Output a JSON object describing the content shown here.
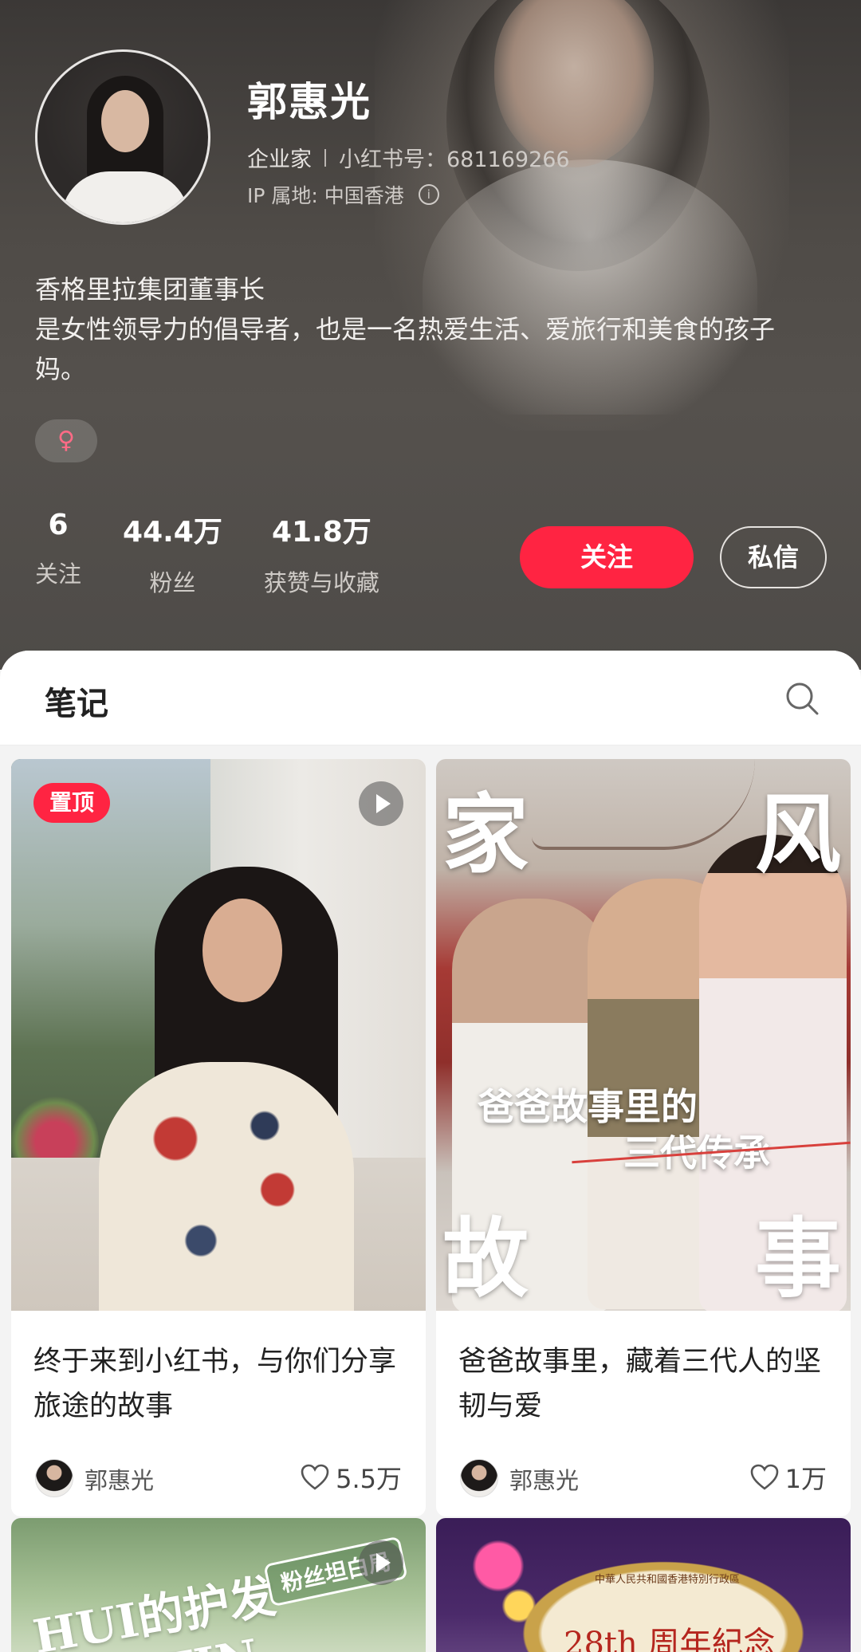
{
  "profile": {
    "name": "郭惠光",
    "role": "企业家",
    "id_label": "小红书号：681169266",
    "ip_location": "IP 属地: 中国香港",
    "info_symbol": "i",
    "bio_line1": "香格里拉集团董事长",
    "bio_line2": "是女性领导力的倡导者，也是一名热爱生活、爱旅行和美食的孩子妈。",
    "gender_symbol": "♀"
  },
  "stats": [
    {
      "value": "6",
      "label": "关注"
    },
    {
      "value": "44.4万",
      "label": "粉丝"
    },
    {
      "value": "41.8万",
      "label": "获赞与收藏"
    }
  ],
  "actions": {
    "follow_label": "关注",
    "message_label": "私信"
  },
  "notes": {
    "title": "笔记",
    "cards": [
      {
        "pin_label": "置顶",
        "title": "终于来到小红书，与你们分享旅途的故事",
        "author": "郭惠光",
        "likes": "5.5万"
      },
      {
        "cover_chars": [
          "家",
          "风",
          "故",
          "事"
        ],
        "cover_line1": "爸爸故事里的",
        "cover_line2": "三代传承",
        "title": "爸爸故事里，藏着三代人的坚韧与爱",
        "author": "郭惠光",
        "likes": "1万"
      },
      {
        "cover_text": "HUI的护发 ROUTIN",
        "cover_badge": "粉丝坦白局"
      },
      {
        "cover_text": "中華人民共和國香港特別行政區",
        "cover_big": "28th 周年紀念"
      }
    ]
  },
  "colors": {
    "accent": "#ff2442",
    "header_bg": "#4f4b47"
  },
  "icons": {
    "search": "search-icon",
    "heart": "heart-icon",
    "play": "play-icon",
    "info": "info-icon"
  }
}
